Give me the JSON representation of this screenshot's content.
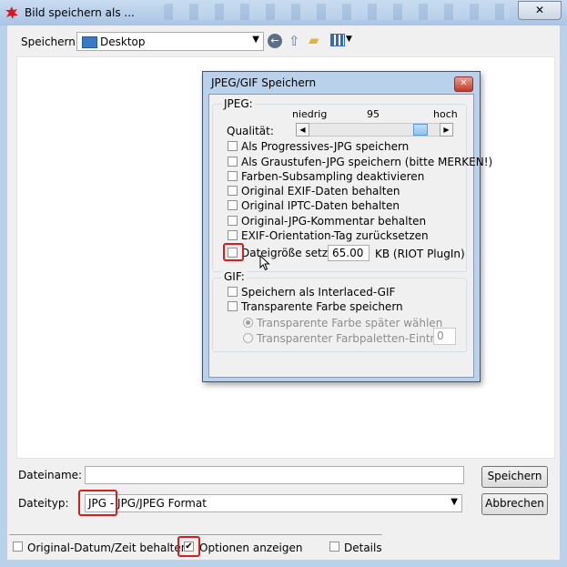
{
  "window": {
    "title": "Bild speichern als ...",
    "close_label": "✕"
  },
  "toolbar": {
    "save_in_label": "Speichern",
    "location": "Desktop"
  },
  "bottom": {
    "filename_label": "Dateiname:",
    "filename_value": "",
    "save_button": "Speichern",
    "filetype_label": "Dateityp:",
    "filetype_value": "JPG - JPG/JPEG Format",
    "cancel_button": "Abbrechen",
    "orig_date_label": "Original-Datum/Zeit behalten",
    "orig_date_checked": false,
    "options_label": "Optionen anzeigen",
    "options_checked": true,
    "options_mark": "✔",
    "details_label": "Details",
    "details_checked": false
  },
  "dialog": {
    "title": "JPEG/GIF Speichern",
    "close_label": "✕",
    "jpeg_group_label": "JPEG:",
    "quality_low": "niedrig",
    "quality_value": "95",
    "quality_high": "hoch",
    "quality_label": "Qualität:",
    "quality_level": 0.9,
    "slider_left": "◀",
    "slider_right": "▶",
    "jpeg_options": [
      {
        "label": "Als Progressives-JPG speichern",
        "checked": false
      },
      {
        "label": "Als Graustufen-JPG speichern (bitte MERKEN!)",
        "checked": false
      },
      {
        "label": "Farben-Subsampling deaktivieren",
        "checked": false
      },
      {
        "label": "Original EXIF-Daten behalten",
        "checked": false
      },
      {
        "label": "Original IPTC-Daten behalten",
        "checked": false
      },
      {
        "label": "Original-JPG-Kommentar behalten",
        "checked": false
      },
      {
        "label": "EXIF-Orientation-Tag zurücksetzen",
        "checked": false
      }
    ],
    "filesize_label": "Dateigröße setzen:",
    "filesize_value": "65.00",
    "filesize_unit": "KB (RIOT PlugIn)",
    "gif_group_label": "GIF:",
    "gif_options": [
      {
        "label": "Speichern als Interlaced-GIF",
        "checked": false
      },
      {
        "label": "Transparente Farbe speichern",
        "checked": false
      }
    ],
    "gif_radio_later": "Transparente Farbe später wählen",
    "gif_radio_palette": "Transparenter Farbpaletten-Eintrag:",
    "palette_value": "0"
  },
  "colors": {
    "highlight": "#d02020",
    "title_bar": "#b9d1ea"
  }
}
